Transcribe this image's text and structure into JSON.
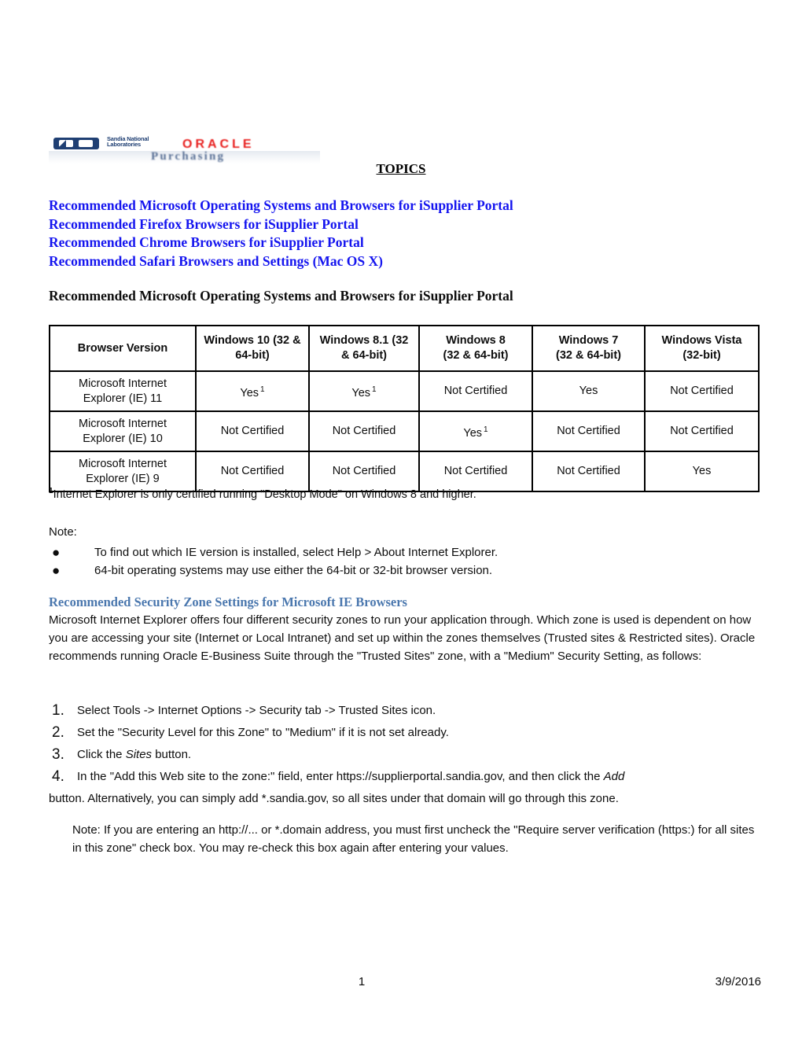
{
  "logo": {
    "sandia_text": "Sandia National Laboratories",
    "oracle_text": "ORACLE",
    "product_text": "Purchasing"
  },
  "topics": {
    "title": "TOPICS",
    "links": [
      "Recommended Microsoft Operating Systems and Browsers for iSupplier Portal",
      "Recommended Firefox Browsers for iSupplier Portal",
      "Recommended Chrome Browsers for iSupplier Portal",
      "Recommended Safari Browsers and Settings (Mac OS X)"
    ]
  },
  "section": {
    "heading": "Recommended Microsoft Operating Systems and Browsers for iSupplier Portal"
  },
  "table": {
    "headers": [
      "Browser Version",
      "Windows 10 (32 & 64-bit)",
      "Windows 8.1 (32 & 64-bit)",
      "Windows 8 (32 & 64-bit)",
      "Windows 7 (32 & 64-bit)",
      "Windows Vista (32-bit)"
    ],
    "header_lines": [
      [
        "Browser Version",
        ""
      ],
      [
        "Windows 10 (32 &",
        "64-bit)"
      ],
      [
        "Windows 8.1 (32",
        "& 64-bit)"
      ],
      [
        "Windows 8",
        "(32 & 64-bit)"
      ],
      [
        "Windows 7",
        "(32 & 64-bit)"
      ],
      [
        "Windows Vista",
        "(32-bit)"
      ]
    ],
    "rows": [
      {
        "label_lines": [
          "Microsoft Internet",
          "Explorer (IE) 11"
        ],
        "cells": [
          {
            "text": "Yes",
            "sup": "1"
          },
          {
            "text": "Yes",
            "sup": "1"
          },
          {
            "text": "Not Certified",
            "sup": ""
          },
          {
            "text": "Yes",
            "sup": ""
          },
          {
            "text": "Not Certified",
            "sup": ""
          }
        ]
      },
      {
        "label_lines": [
          "Microsoft Internet",
          "Explorer (IE) 10"
        ],
        "cells": [
          {
            "text": "Not Certified",
            "sup": ""
          },
          {
            "text": "Not Certified",
            "sup": ""
          },
          {
            "text": "Yes",
            "sup": "1"
          },
          {
            "text": "Not Certified",
            "sup": ""
          },
          {
            "text": "Not Certified",
            "sup": ""
          }
        ]
      },
      {
        "label_lines": [
          "Microsoft Internet",
          "Explorer (IE) 9"
        ],
        "cells": [
          {
            "text": "Not Certified",
            "sup": ""
          },
          {
            "text": "Not Certified",
            "sup": ""
          },
          {
            "text": "Not Certified",
            "sup": ""
          },
          {
            "text": "Not Certified",
            "sup": ""
          },
          {
            "text": "Yes",
            "sup": ""
          }
        ]
      }
    ]
  },
  "footnote": {
    "mark": "1",
    "text": "Internet Explorer is only certified running \"Desktop Mode\" on Windows 8 and higher."
  },
  "note": {
    "label": "Note:",
    "bullet_glyph": "●",
    "items": [
      "To find out which IE version is installed, select Help > About Internet Explorer.",
      "64-bit operating systems may use either the 64-bit or 32-bit browser version."
    ]
  },
  "security": {
    "heading": "Recommended Security Zone Settings for Microsoft IE Browsers",
    "paragraph": "Microsoft Internet Explorer offers four different security zones to run your application  through. Which zone is used is dependent on how you are accessing your site (Internet or Local  Intranet) and set up within the zones themselves (Trusted sites & Restricted sites). Oracle recommends running Oracle E-Business Suite through the \"Trusted  Sites\" zone, with a \"Medium\" Security Setting, as follows:"
  },
  "steps": {
    "items": [
      {
        "num": "1.",
        "text": "Select Tools -> Internet Options -> Security tab -> Trusted Sites icon."
      },
      {
        "num": "2.",
        "text": "Set the \"Security Level for this Zone\" to \"Medium\" if it is not set already."
      },
      {
        "num": "3.",
        "pre": "Click the ",
        "italic": "Sites",
        "post": " button."
      },
      {
        "num": "4.",
        "pre": "In the \"Add this Web site to the zone:\" field, enter  https://supplierportal.sandia.gov, and then  click the ",
        "italic": "Add",
        "post": ""
      }
    ],
    "step4_continuation": "button. Alternatively, you can simply add *.sandia.gov, so all sites under that domain will go through this zone."
  },
  "trailing_note": "Note: If you are entering an http://... or *.domain address, you must first uncheck the \"Require server verification (https:) for all sites in this zone\" check box. You may re-check this box again after entering your values.",
  "footer": {
    "page_number": "1",
    "date": "3/9/2016"
  },
  "colors": {
    "topic_link": "#1515EF",
    "security_heading": "#4A77AE",
    "oracle_red": "#E8201F",
    "sandia_blue": "#1F3F73"
  }
}
